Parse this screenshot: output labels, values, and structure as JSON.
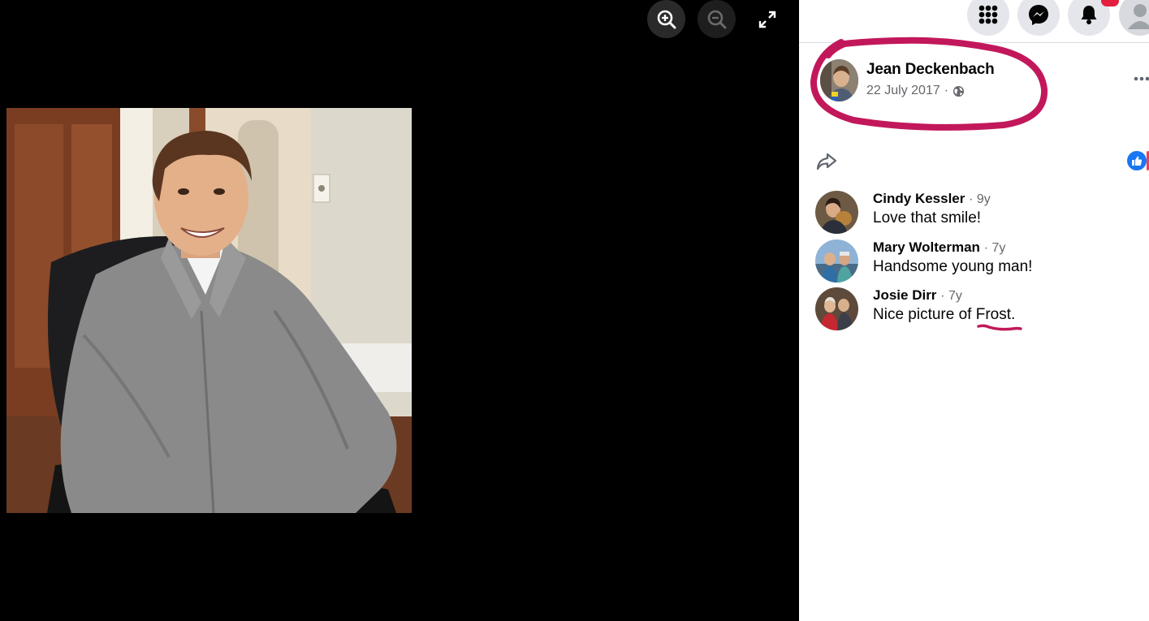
{
  "viewer": {
    "zoom_in_icon": "zoom-in-icon",
    "zoom_out_icon": "zoom-out-icon",
    "fullscreen_icon": "expand-icon"
  },
  "nav": {
    "icons": [
      "grid-menu-icon",
      "messenger-icon",
      "bell-icon",
      "account-avatar"
    ],
    "badge_color": "#e41e3f"
  },
  "post": {
    "author": "Jean Deckenbach",
    "date": "22 July 2017",
    "separator": "·",
    "privacy_icon": "globe-icon",
    "annotation_color": "#c2185b"
  },
  "reactions": {
    "icons": [
      "like-icon",
      "love-icon"
    ]
  },
  "comments": [
    {
      "name": "Cindy Kessler",
      "time": "· 9y",
      "text": "Love that smile!"
    },
    {
      "name": "Mary Wolterman",
      "time": "· 7y",
      "text": "Handsome young man!"
    },
    {
      "name": "Josie Dirr",
      "time": "· 7y",
      "text": "Nice picture of Frost."
    }
  ]
}
